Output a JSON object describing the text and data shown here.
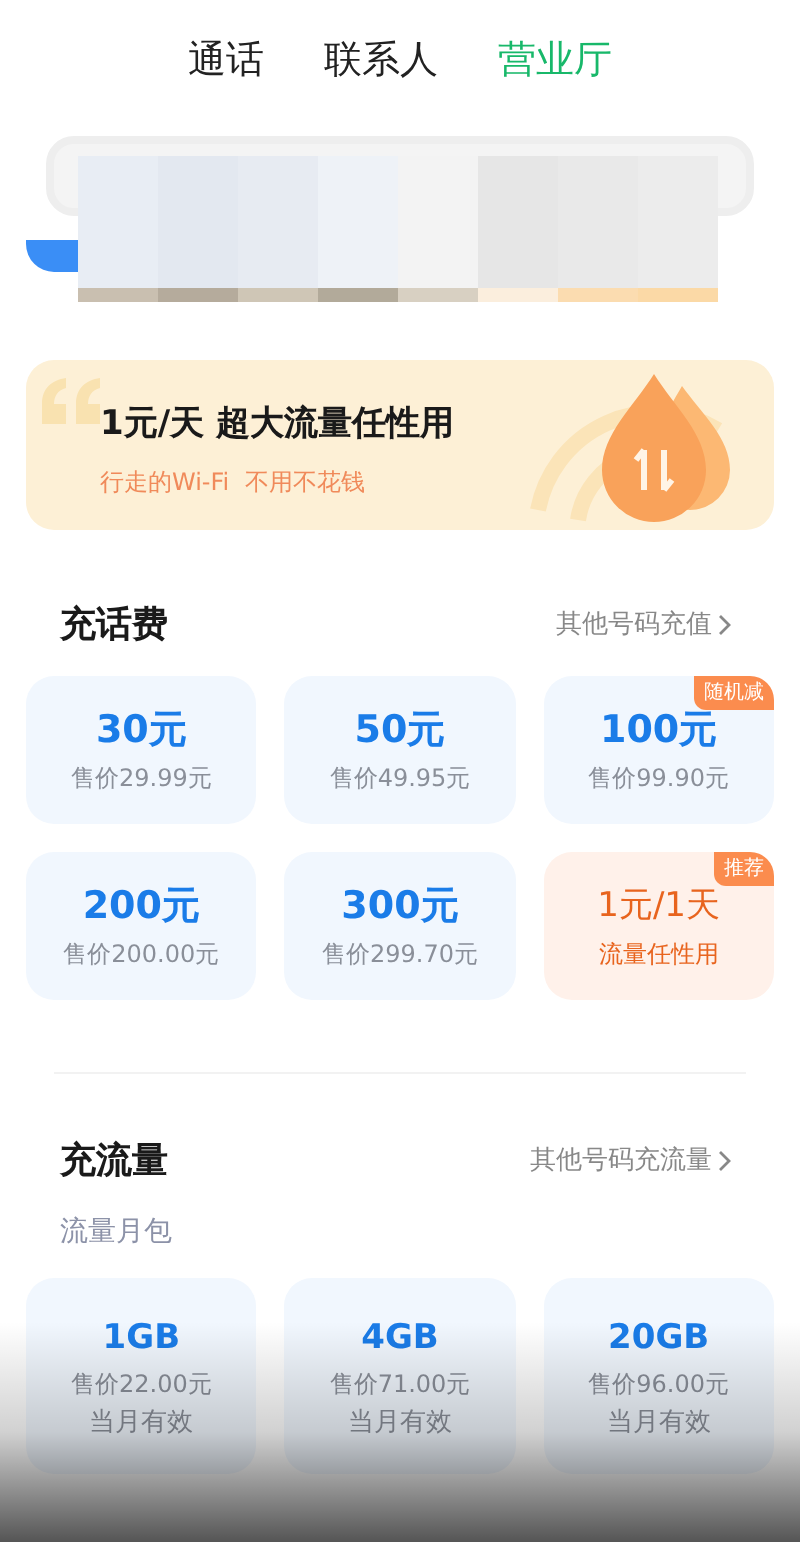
{
  "tabs": [
    {
      "label": "通话",
      "selected": false
    },
    {
      "label": "联系人",
      "selected": false
    },
    {
      "label": "营业厅",
      "selected": true
    }
  ],
  "banner": {
    "title": "1元/天 超大流量任性用",
    "subtitle": "行走的Wi-Fi  不用不花钱"
  },
  "recharge": {
    "title": "充话费",
    "link": "其他号码充值",
    "items": [
      {
        "kind": "price",
        "amount": "30元",
        "price": "售价29.99元"
      },
      {
        "kind": "price",
        "amount": "50元",
        "price": "售价49.95元"
      },
      {
        "kind": "price",
        "amount": "100元",
        "price": "售价99.90元",
        "badge": "随机减"
      },
      {
        "kind": "price",
        "amount": "200元",
        "price": "售价200.00元"
      },
      {
        "kind": "price",
        "amount": "300元",
        "price": "售价299.70元"
      },
      {
        "kind": "promo",
        "amount": "1元/1天",
        "price": "流量任性用",
        "badge": "推荐"
      }
    ]
  },
  "data": {
    "title": "充流量",
    "link": "其他号码充流量",
    "subtitle": "流量月包",
    "items": [
      {
        "amount": "1GB",
        "price": "售价22.00元",
        "validity": "当月有效"
      },
      {
        "amount": "4GB",
        "price": "售价71.00元",
        "validity": "当月有效"
      },
      {
        "amount": "20GB",
        "price": "售价96.00元",
        "validity": "当月有效"
      }
    ]
  }
}
